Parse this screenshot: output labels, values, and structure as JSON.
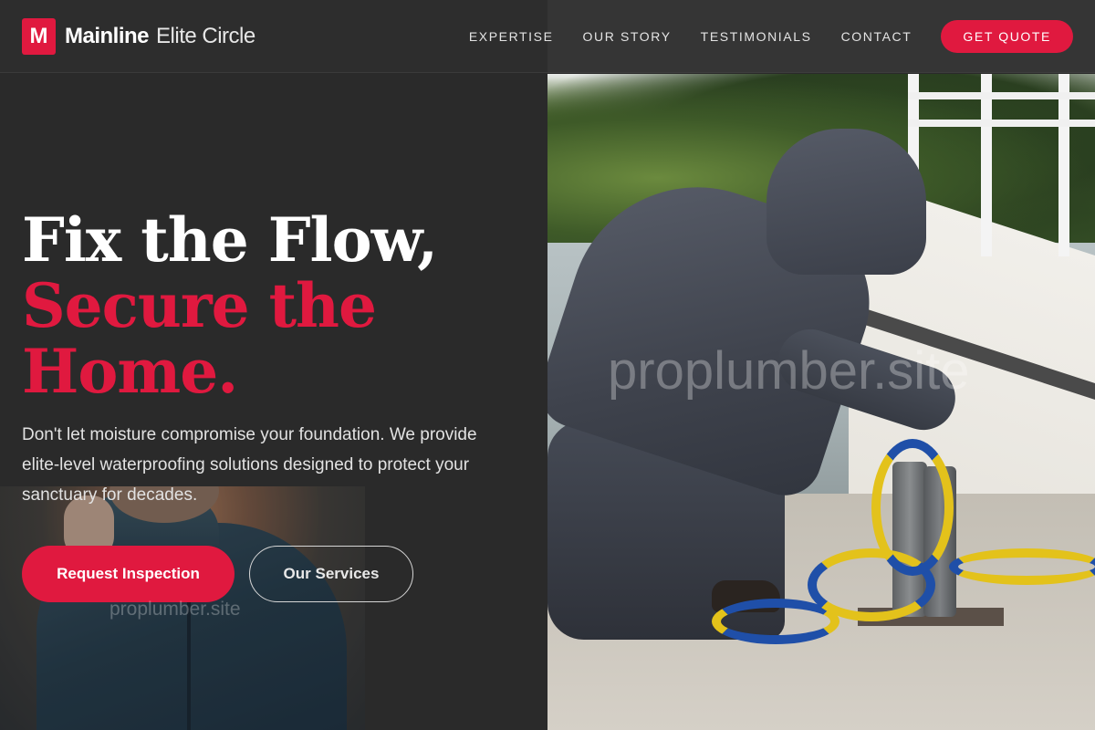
{
  "brand": {
    "logo_letter": "M",
    "name_bold": "Mainline",
    "name_light": "Elite Circle",
    "accent_color": "#e0193f"
  },
  "nav": {
    "items": [
      "EXPERTISE",
      "OUR STORY",
      "TESTIMONIALS",
      "CONTACT"
    ],
    "cta": "GET QUOTE"
  },
  "hero": {
    "headline_line1": "Fix the Flow,",
    "headline_line2": "Secure the",
    "headline_line3": "Home.",
    "description": "Don't let moisture compromise your foundation. We provide elite-level waterproofing solutions designed to protect your sanctuary for decades.",
    "primary_button": "Request Inspection",
    "secondary_button": "Our Services"
  },
  "watermarks": {
    "left": "proplumber.site",
    "right": "proplumber.site"
  }
}
